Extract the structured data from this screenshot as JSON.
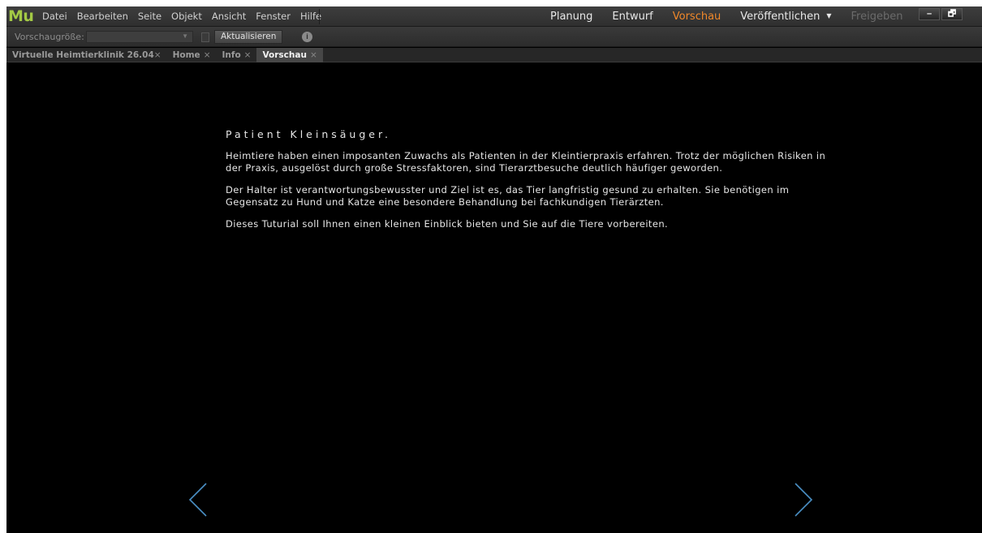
{
  "app": {
    "logo": "Mu"
  },
  "menu": [
    "Datei",
    "Bearbeiten",
    "Seite",
    "Objekt",
    "Ansicht",
    "Fenster",
    "Hilfe"
  ],
  "modes": {
    "planning": "Planung",
    "design": "Entwurf",
    "preview": "Vorschau",
    "publish": "Veröffentlichen",
    "share": "Freigeben"
  },
  "window_controls": {
    "minimize": "–",
    "restore": "🗗"
  },
  "toolbar": {
    "size_label": "Vorschaugröße:",
    "size_value": "",
    "refresh": "Aktualisieren"
  },
  "tabs": [
    {
      "label": "Virtuelle Heimtierklinik 26.04",
      "close": "×"
    },
    {
      "label": "Home",
      "close": "×"
    },
    {
      "label": "Info",
      "close": "×"
    },
    {
      "label": "Vorschau",
      "close": "×"
    }
  ],
  "active_tab": "Vorschau",
  "content": {
    "heading": "Patient Kleinsäuger.",
    "paragraphs": [
      "Heimtiere haben einen imposanten Zuwachs als Patienten in der Kleintierpraxis erfahren. Trotz der möglichen Risiken in der Praxis, ausgelöst durch große Stressfaktoren, sind Tierarztbesuche deutlich häufiger geworden.",
      "Der Halter ist verantwortungsbewusster und Ziel ist es, das Tier langfristig gesund zu erhalten. Sie benötigen im Gegensatz zu Hund und Katze eine besondere Behandlung bei fachkundigen Tierärzten.",
      "Dieses Tuturial soll Ihnen einen kleinen Einblick bieten und Sie auf die Tiere vorbereiten."
    ]
  },
  "colors": {
    "accent": "#f0882a",
    "logo": "#a3c945",
    "nav_arrow": "#4a8fc4"
  },
  "icons": {
    "prev": "chevron-left-icon",
    "next": "chevron-right-icon",
    "info": "info-icon"
  }
}
